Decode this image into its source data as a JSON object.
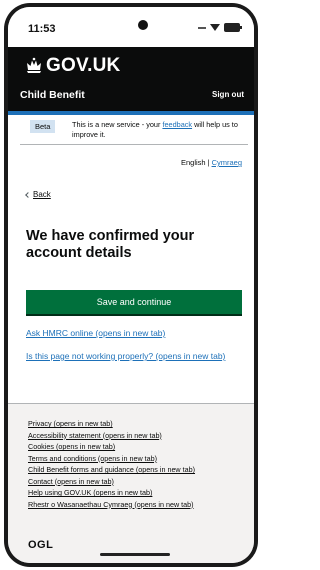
{
  "status_bar": {
    "time": "11:53"
  },
  "header": {
    "logo_text": "GOV.UK",
    "service_name": "Child Benefit",
    "sign_out_label": "Sign out"
  },
  "phase_banner": {
    "tag": "Beta",
    "text_before": "This is a new service - your ",
    "feedback_link": "feedback",
    "text_after": " will help us to improve it."
  },
  "language": {
    "english": "English",
    "separator": "|",
    "welsh": "Cymraeg"
  },
  "back_link": "Back",
  "heading": "We have confirmed your account details",
  "primary_button": "Save and continue",
  "links": {
    "ask_hmrc": "Ask HMRC online (opens in new tab)",
    "not_working": "Is this page not working properly? (opens in new tab)"
  },
  "footer": {
    "items": [
      "Privacy (opens in new tab)",
      "Accessibility statement (opens in new tab)",
      "Cookies (opens in new tab)",
      "Terms and conditions (opens in new tab)",
      "Child Benefit forms and guidance (opens in new tab)",
      "Contact (opens in new tab)",
      "Help using GOV.UK (opens in new tab)",
      "Rhestr o Wasanaethau Cymraeg (opens in new tab)"
    ],
    "ogl_label": "OGL"
  },
  "colors": {
    "header_bg": "#0b0c0c",
    "accent_blue": "#1d70b8",
    "button_green": "#00703c",
    "footer_bg": "#f3f2f1"
  },
  "icons": {
    "crown": "crown-icon",
    "wifi": "wifi-icon",
    "battery": "battery-icon",
    "back": "chevron-left-icon"
  }
}
